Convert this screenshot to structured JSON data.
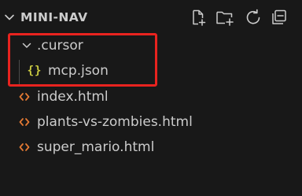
{
  "explorer": {
    "title": "MINI-NAV",
    "expanded": true,
    "actions": [
      {
        "name": "new-file-icon",
        "tooltip": "New File"
      },
      {
        "name": "new-folder-icon",
        "tooltip": "New Folder"
      },
      {
        "name": "refresh-icon",
        "tooltip": "Refresh Explorer"
      },
      {
        "name": "collapse-all-icon",
        "tooltip": "Collapse Folders in Explorer"
      }
    ]
  },
  "tree": {
    "folder": {
      "label": ".cursor",
      "icon": "chevron-down-icon",
      "expanded": true
    },
    "folder_children": [
      {
        "label": "mcp.json",
        "icon": "json-icon",
        "icon_glyph": "{}"
      }
    ],
    "files": [
      {
        "label": "index.html",
        "icon": "html-icon"
      },
      {
        "label": "plants-vs-zombies.html",
        "icon": "html-icon"
      },
      {
        "label": "super_mario.html",
        "icon": "html-icon"
      }
    ]
  },
  "colors": {
    "background": "#181818",
    "text": "#cccccc",
    "html_icon": "#e37933",
    "json_icon": "#cbcb41",
    "highlight_box": "#e8231f"
  }
}
